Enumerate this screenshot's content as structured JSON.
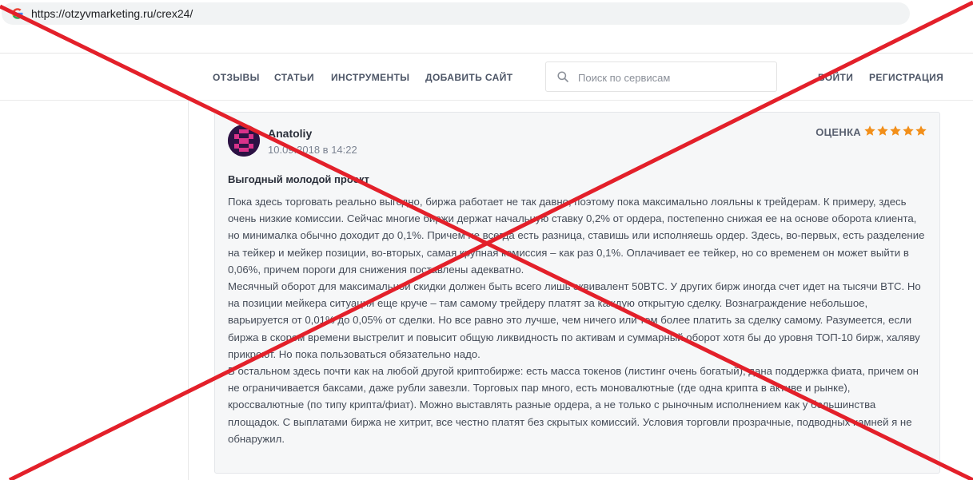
{
  "browser": {
    "url": "https://otzyvmarketing.ru/crex24/"
  },
  "nav": {
    "items": [
      "ОТЗЫВЫ",
      "СТАТЬИ",
      "ИНСТРУМЕНТЫ",
      "ДОБАВИТЬ САЙТ"
    ],
    "search_placeholder": "Поиск по сервисам",
    "login": "ВОЙТИ",
    "register": "РЕГИСТРАЦИЯ"
  },
  "review": {
    "author": "Anatoliy",
    "date": "10.09.2018 в 14:22",
    "rating_label": "ОЦЕНКА",
    "rating": 5,
    "rating_max": 5,
    "title": "Выгодный молодой проект",
    "paragraphs": [
      "Пока здесь торговать реально выгодно, биржа работает не так давно, поэтому пока максимально лояльны к трейдерам. К примеру, здесь очень низкие комиссии. Сейчас многие биржи держат начальную ставку 0,2% от ордера, постепенно снижая ее на основе оборота клиента, но минималка обычно доходит до 0,1%. Причем не всегда есть разница, ставишь или исполняешь ордер. Здесь, во-первых, есть разделение на тейкер и мейкер позиции, во-вторых, самая крупная комиссия – как раз 0,1%. Оплачивает ее тейкер, но со временем он может выйти в 0,06%, причем пороги для снижения поставлены адекватно.",
      "Месячный оборот для максимальной скидки должен быть всего лишь эквивалент 50BTC. У других бирж иногда счет идет на тысячи BTC. Но на позиции мейкера ситуация еще круче – там самому трейдеру платят за каждую открытую сделку. Вознаграждение небольшое, варьируется от 0,01% до 0,05% от сделки. Но все равно это лучше, чем ничего или тем более платить за сделку самому. Разумеется, если биржа в скором времени выстрелит и повысит общую ликвидность по активам и суммарный оборот хотя бы до уровня ТОП-10 бирж, халяву прикроют. Но пока пользоваться обязательно надо.",
      "В остальном здесь почти как на любой другой криптобирже: есть масса токенов (листинг очень богатый), дана поддержка фиата, причем он не ограничивается баксами, даже рубли завезли. Торговых пар много, есть моновалютные (где одна крипта в активе и рынке), кроссвалютные (по типу крипта/фиат). Можно выставлять разные ордера, а не только с рыночным исполнением как у большинства площадок. С выплатами биржа не хитрит, все честно платят без скрытых комиссий. Условия торговли прозрачные, подводных камней я не обнаружил."
    ]
  },
  "colors": {
    "cross": "#e3202a",
    "star": "#f28f1a",
    "avatar_bg": "#2c1244",
    "avatar_fg": "#d9328a"
  },
  "icons": {
    "browser": "google-g-icon",
    "search": "search-icon",
    "star": "star-icon"
  }
}
